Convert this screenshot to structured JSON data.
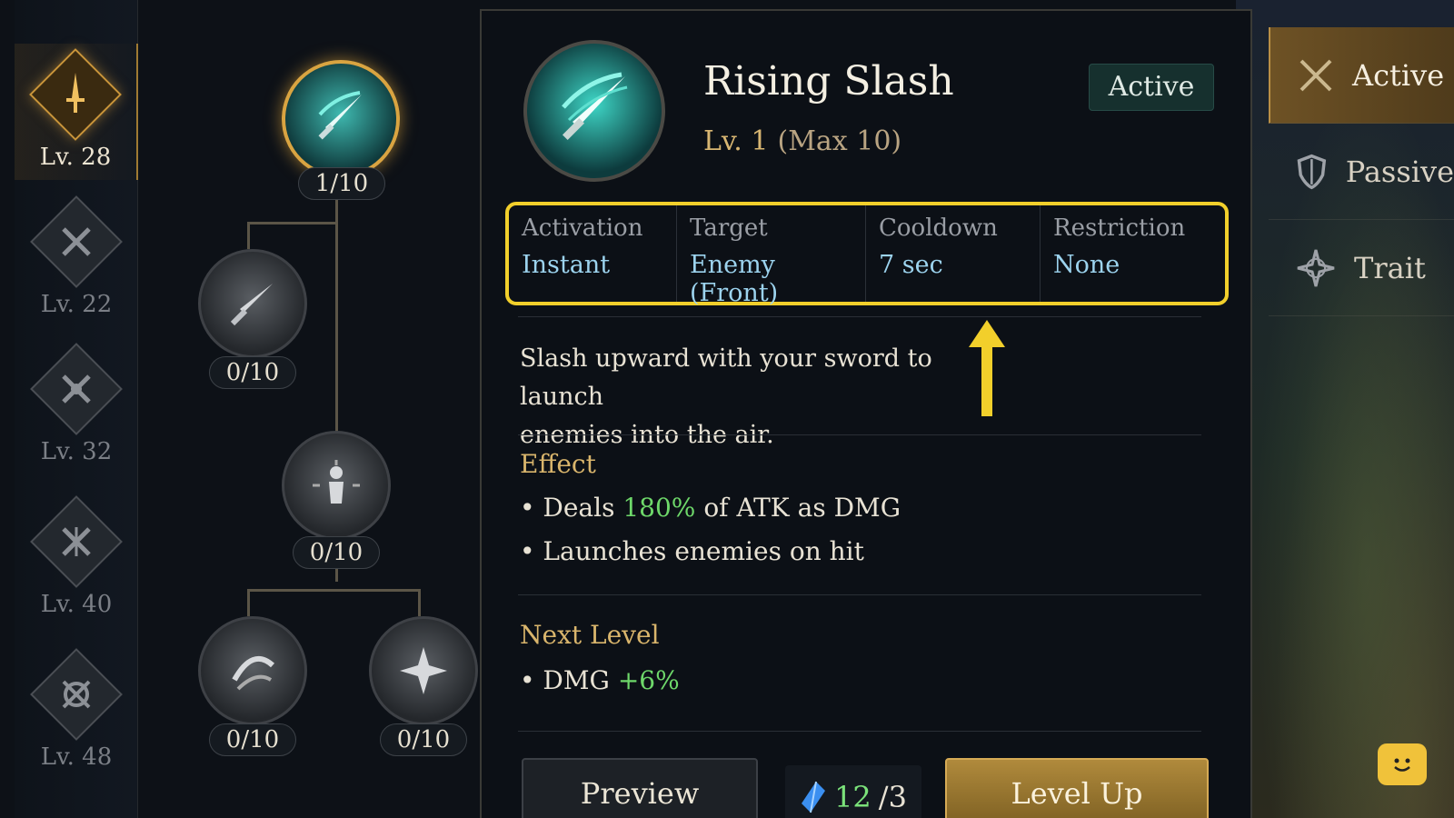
{
  "levels": [
    {
      "label": "Lv. 28",
      "selected": true
    },
    {
      "label": "Lv. 22"
    },
    {
      "label": "Lv. 32"
    },
    {
      "label": "Lv. 40"
    },
    {
      "label": "Lv. 48"
    }
  ],
  "tree": {
    "nodes": [
      {
        "count": "1/10"
      },
      {
        "count": "0/10"
      },
      {
        "count": "0/10"
      },
      {
        "count": "0/10"
      },
      {
        "count": "0/10"
      }
    ]
  },
  "skill": {
    "title": "Rising Slash",
    "level": "Lv. 1",
    "max": "(Max 10)",
    "badge": "Active",
    "info": [
      {
        "header": "Activation",
        "value": "Instant"
      },
      {
        "header": "Target",
        "value": "Enemy (Front)"
      },
      {
        "header": "Cooldown",
        "value": "7 sec"
      },
      {
        "header": "Restriction",
        "value": "None"
      }
    ],
    "description_1": "Slash upward with your sword to launch",
    "description_2": "enemies into the air.",
    "effect_header": "Effect",
    "effect_1_pre": "• Deals ",
    "effect_1_value": "180%",
    "effect_1_post": " of ATK as DMG",
    "effect_2": "• Launches enemies on hit",
    "next_header": "Next Level",
    "next_1_pre": "• DMG ",
    "next_1_value": "+6%"
  },
  "actions": {
    "preview": "Preview",
    "cost_have": "12",
    "cost_need": "/3",
    "level_up": "Level Up"
  },
  "tabs": [
    {
      "label": "Active",
      "icon": "crossed-swords-icon",
      "selected": true
    },
    {
      "label": "Passive",
      "icon": "shield-icon"
    },
    {
      "label": "Trait",
      "icon": "compass-star-icon"
    }
  ],
  "colors": {
    "accent_gold": "#d9a441",
    "highlight_yellow": "#f2cf2b",
    "value_green": "#6ed86a",
    "info_value_blue": "#9cd3ee"
  }
}
